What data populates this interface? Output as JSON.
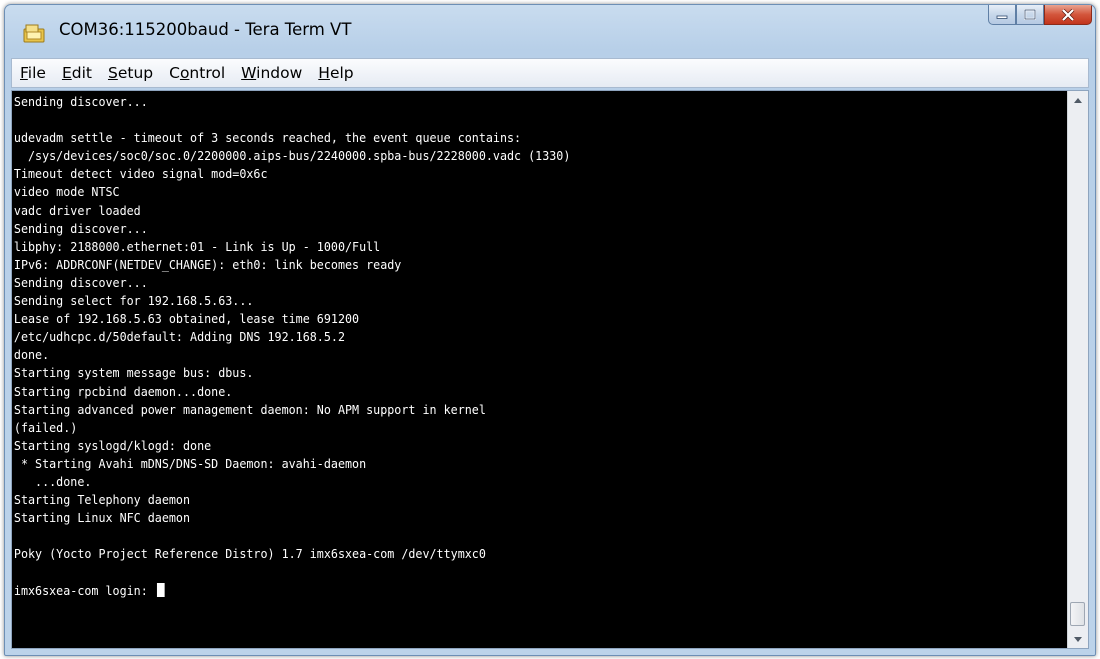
{
  "window": {
    "title": "COM36:115200baud - Tera Term VT",
    "icon": "teraterm-app-icon",
    "controls": [
      "minimize-icon",
      "maximize-icon",
      "close-icon"
    ],
    "colors": {
      "close_button": "#c7432b",
      "title_bar": "#c3d8ee"
    }
  },
  "menu": [
    {
      "pre": "",
      "mnemonic": "F",
      "post": "ile"
    },
    {
      "pre": "",
      "mnemonic": "E",
      "post": "dit"
    },
    {
      "pre": "",
      "mnemonic": "S",
      "post": "etup"
    },
    {
      "pre": "C",
      "mnemonic": "o",
      "post": "ntrol"
    },
    {
      "pre": "",
      "mnemonic": "W",
      "post": "indow"
    },
    {
      "pre": "",
      "mnemonic": "H",
      "post": "elp"
    }
  ],
  "terminal": {
    "background": "#000000",
    "foreground": "#ffffff",
    "lines": [
      "Sending discover...",
      "",
      "udevadm settle - timeout of 3 seconds reached, the event queue contains:",
      "  /sys/devices/soc0/soc.0/2200000.aips-bus/2240000.spba-bus/2228000.vadc (1330)",
      "Timeout detect video signal mod=0x6c",
      "video mode NTSC",
      "vadc driver loaded",
      "Sending discover...",
      "libphy: 2188000.ethernet:01 - Link is Up - 1000/Full",
      "IPv6: ADDRCONF(NETDEV_CHANGE): eth0: link becomes ready",
      "Sending discover...",
      "Sending select for 192.168.5.63...",
      "Lease of 192.168.5.63 obtained, lease time 691200",
      "/etc/udhcpc.d/50default: Adding DNS 192.168.5.2",
      "done.",
      "Starting system message bus: dbus.",
      "Starting rpcbind daemon...done.",
      "Starting advanced power management daemon: No APM support in kernel",
      "(failed.)",
      "Starting syslogd/klogd: done",
      " * Starting Avahi mDNS/DNS-SD Daemon: avahi-daemon",
      "   ...done.",
      "Starting Telephony daemon",
      "Starting Linux NFC daemon",
      "",
      "Poky (Yocto Project Reference Distro) 1.7 imx6sxea-com /dev/ttymxc0",
      ""
    ],
    "prompt": "imx6sxea-com login: ",
    "scroll_position": 1.0
  }
}
